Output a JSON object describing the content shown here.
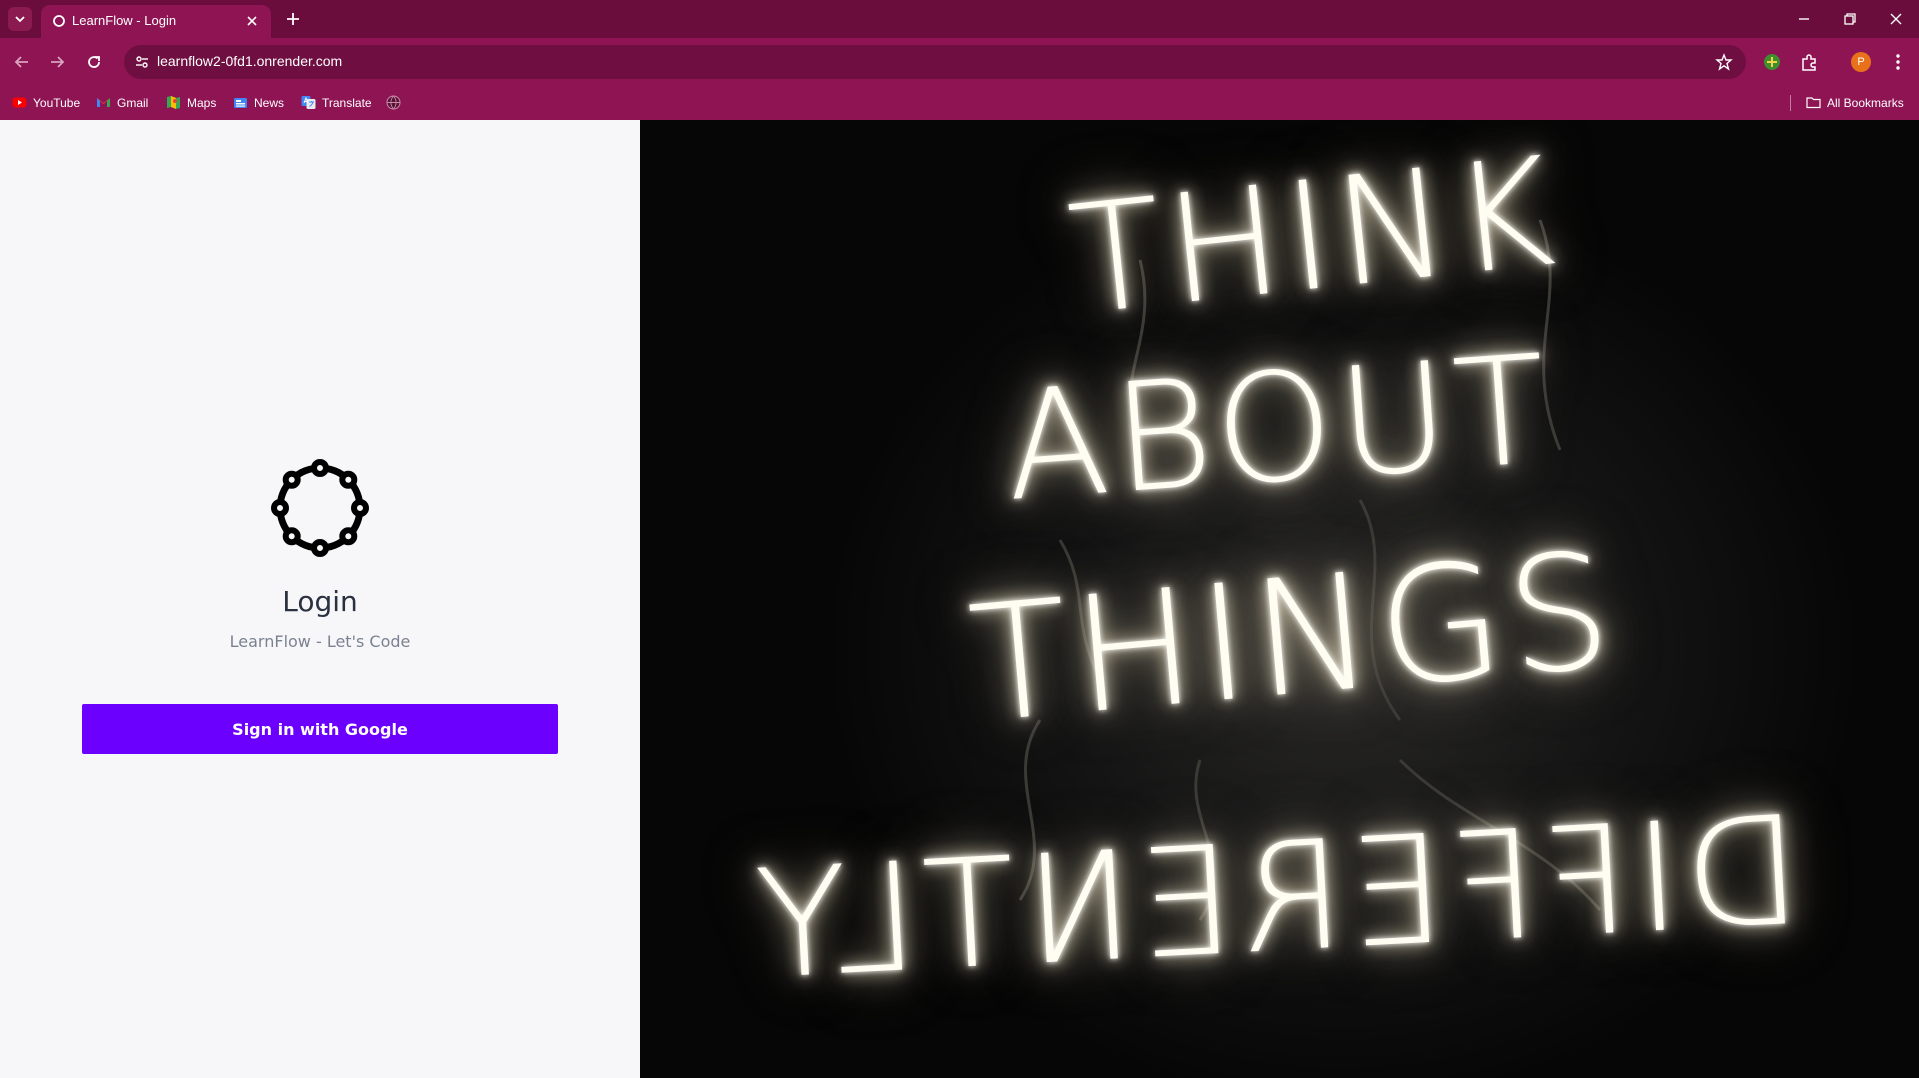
{
  "browser": {
    "tab": {
      "title": "LearnFlow - Login"
    },
    "address": {
      "url": "learnflow2-0fd1.onrender.com"
    },
    "profile_initial": "P",
    "bookmarks": [
      {
        "label": "YouTube",
        "icon": "youtube-icon"
      },
      {
        "label": "Gmail",
        "icon": "gmail-icon"
      },
      {
        "label": "Maps",
        "icon": "maps-icon"
      },
      {
        "label": "News",
        "icon": "news-icon"
      },
      {
        "label": "Translate",
        "icon": "translate-icon"
      }
    ],
    "all_bookmarks_label": "All Bookmarks",
    "colors": {
      "frame": "#6b0d3c",
      "toolbar": "#8f1454"
    }
  },
  "login": {
    "title": "Login",
    "subtitle": "LearnFlow - Let's Code",
    "google_button": "Sign in with Google",
    "button_color": "#6c00ff"
  },
  "hero": {
    "words": [
      "THINK",
      "ABOUT",
      "THINGS",
      "DIFFERENTLY"
    ]
  }
}
